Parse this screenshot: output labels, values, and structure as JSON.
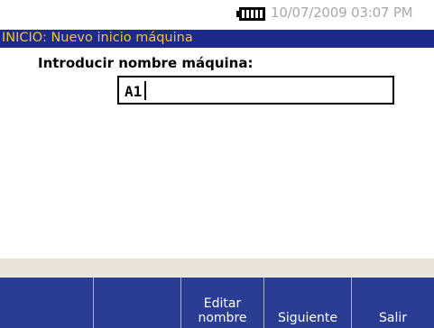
{
  "status": {
    "battery_icon": "battery-full-icon",
    "datetime": "10/07/2009 03:07 PM"
  },
  "title": "INICIO: Nuevo inicio máquina",
  "prompt": "Introducir nombre máquina:",
  "name_field": {
    "value": "A1"
  },
  "softkeys": [
    {
      "label": ""
    },
    {
      "label": ""
    },
    {
      "label": "Editar\nnombre"
    },
    {
      "label": "Siguiente"
    },
    {
      "label": "Salir"
    }
  ],
  "colors": {
    "title_bar": "#1c2a8c",
    "title_text": "#f0c43a",
    "softkey_bar": "#2a3d92",
    "info_strip": "#e9e3d8"
  }
}
